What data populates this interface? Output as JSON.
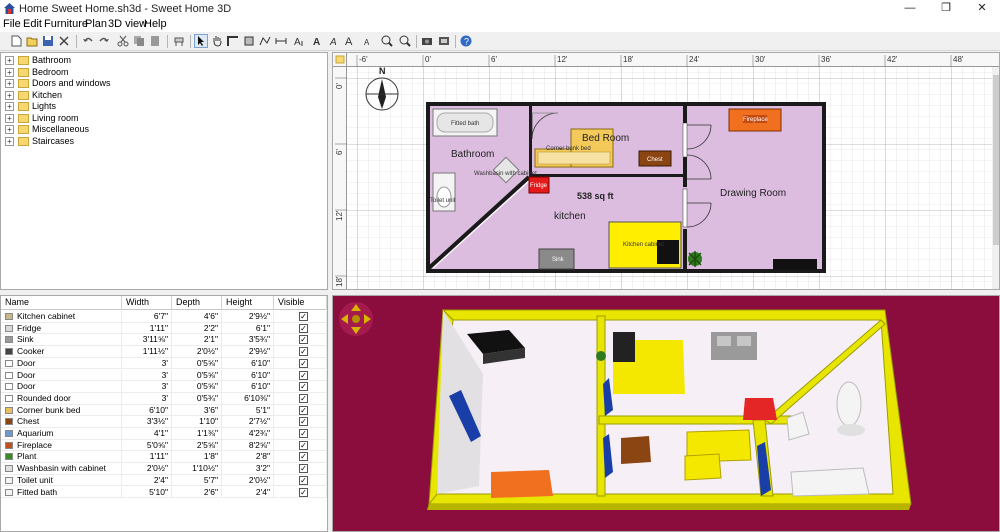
{
  "window": {
    "title": "Home Sweet Home.sh3d - Sweet Home 3D",
    "minimize": "—",
    "maximize": "❐",
    "close": "✕"
  },
  "menu": [
    "File",
    "Edit",
    "Furniture",
    "Plan",
    "3D view",
    "Help"
  ],
  "toolbar": [
    {
      "icon": "new-icon"
    },
    {
      "icon": "open-icon"
    },
    {
      "icon": "save-icon"
    },
    {
      "icon": "cut-preferences-icon"
    },
    {
      "icon": "undo-icon"
    },
    {
      "icon": "redo-icon"
    },
    {
      "icon": "cut-icon"
    },
    {
      "icon": "copy-icon"
    },
    {
      "icon": "paste-icon"
    },
    {
      "icon": "add-furniture-icon"
    },
    {
      "icon": "select-mode-icon",
      "selected": true
    },
    {
      "icon": "pan-mode-icon"
    },
    {
      "icon": "create-walls-icon"
    },
    {
      "icon": "create-rooms-icon"
    },
    {
      "icon": "create-polylines-icon"
    },
    {
      "icon": "create-dimensions-icon"
    },
    {
      "icon": "create-labels-icon"
    },
    {
      "icon": "text-bold-icon"
    },
    {
      "icon": "text-italic-icon"
    },
    {
      "icon": "increase-text-icon"
    },
    {
      "icon": "decrease-text-icon"
    },
    {
      "icon": "zoom-in-icon"
    },
    {
      "icon": "zoom-out-icon"
    },
    {
      "icon": "create-photo-icon"
    },
    {
      "icon": "create-video-icon"
    },
    {
      "icon": "help-icon"
    }
  ],
  "catalog": [
    "Bathroom",
    "Bedroom",
    "Doors and windows",
    "Kitchen",
    "Lights",
    "Living room",
    "Miscellaneous",
    "Staircases"
  ],
  "furniture_table": {
    "headers": [
      "Name",
      "Width",
      "Depth",
      "Height",
      "Visible"
    ],
    "rows": [
      {
        "name": "Kitchen cabinet",
        "width": "6'7\"",
        "depth": "4'6\"",
        "height": "2'9½\"",
        "visible": "✓",
        "icon": "#c8b88a"
      },
      {
        "name": "Fridge",
        "width": "1'11\"",
        "depth": "2'2\"",
        "height": "6'1\"",
        "visible": "✓",
        "icon": "#d8d8d8"
      },
      {
        "name": "Sink",
        "width": "3'11⅝\"",
        "depth": "2'1\"",
        "height": "3'5¾\"",
        "visible": "✓",
        "icon": "#9a9a9a"
      },
      {
        "name": "Cooker",
        "width": "1'11½\"",
        "depth": "2'0½\"",
        "height": "2'9½\"",
        "visible": "✓",
        "icon": "#444444"
      },
      {
        "name": "Door",
        "width": "3'",
        "depth": "0'5⅝\"",
        "height": "6'10\"",
        "visible": "✓",
        "icon": "#ffffff"
      },
      {
        "name": "Door",
        "width": "3'",
        "depth": "0'5⅝\"",
        "height": "6'10\"",
        "visible": "✓",
        "icon": "#ffffff"
      },
      {
        "name": "Door",
        "width": "3'",
        "depth": "0'5⅝\"",
        "height": "6'10\"",
        "visible": "✓",
        "icon": "#ffffff"
      },
      {
        "name": "Rounded door",
        "width": "3'",
        "depth": "0'5¾\"",
        "height": "6'10⅜\"",
        "visible": "✓",
        "icon": "#ffffff"
      },
      {
        "name": "Corner bunk bed",
        "width": "6'10\"",
        "depth": "3'6\"",
        "height": "5'1\"",
        "visible": "✓",
        "icon": "#e8c060"
      },
      {
        "name": "Chest",
        "width": "3'3½\"",
        "depth": "1'10\"",
        "height": "2'7½\"",
        "visible": "✓",
        "icon": "#8b4513"
      },
      {
        "name": "Aquarium",
        "width": "4'1\"",
        "depth": "1'1⅜\"",
        "height": "4'2¾\"",
        "visible": "✓",
        "icon": "#6a9ad0"
      },
      {
        "name": "Fireplace",
        "width": "5'0⅝\"",
        "depth": "2'5⅝\"",
        "height": "8'2⅝\"",
        "visible": "✓",
        "icon": "#c05020"
      },
      {
        "name": "Plant",
        "width": "1'11\"",
        "depth": "1'8\"",
        "height": "2'8\"",
        "visible": "✓",
        "icon": "#3a8a2a"
      },
      {
        "name": "Washbasin with cabinet",
        "width": "2'0½\"",
        "depth": "1'10½\"",
        "height": "3'2\"",
        "visible": "✓",
        "icon": "#e0e0e0"
      },
      {
        "name": "Toilet unit",
        "width": "2'4\"",
        "depth": "5'7\"",
        "height": "2'0½\"",
        "visible": "✓",
        "icon": "#f4f4f4"
      },
      {
        "name": "Fitted bath",
        "width": "5'10\"",
        "depth": "2'6\"",
        "height": "2'4\"",
        "visible": "✓",
        "icon": "#f4f4f4"
      }
    ]
  },
  "plan": {
    "ruler_x": [
      "-6'",
      "0'",
      "6'",
      "12'",
      "18'",
      "24'",
      "30'",
      "36'",
      "42'",
      "48'"
    ],
    "ruler_y": [
      "0'",
      "6'",
      "12'",
      "18'"
    ],
    "compass_label": "N",
    "rooms": {
      "bathroom": "Bathroom",
      "bedroom": "Bed Room",
      "drawing": "Drawing Room",
      "kitchen": "kitchen"
    },
    "area": "538 sq ft",
    "furniture": {
      "fitted_bath": "Fitted bath",
      "corner_bunk_bed": "Corner bunk bed",
      "chest": "Chest",
      "fireplace": "Fireplace",
      "washbasin": "Washbasin with cabinet",
      "fridge": "Fridge",
      "toilet": "Toilet unit",
      "kitchen_cabinet": "Kitchen cabinet",
      "sink": "Sink"
    }
  },
  "colors": {
    "room_fill": "#dcbde0",
    "view3d_bg": "#8a0d3e",
    "walls3d": "#e8e600",
    "floor3d": "#f6f0f6",
    "bedroom_desk": "#f4e800",
    "fireplace": "#f07020"
  }
}
